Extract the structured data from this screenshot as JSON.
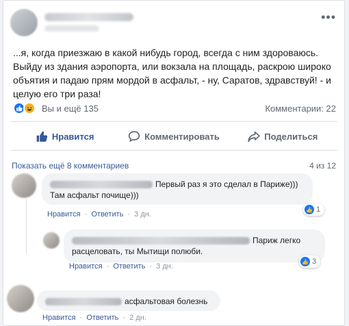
{
  "post": {
    "more_label": "•••",
    "text": "...я, когда приезжаю в какой нибудь город, всегда с ним здороваюсь. Выйду из здания аэропорта, или вокзала на площадь, раскрою широко объятия и падаю прям мордой в асфальт, - ну, Саратов, здравствуй! - и целую его три раза!",
    "reactions_text": "Вы и ещё 135",
    "comments_count": "Комментарии: 22",
    "actions": {
      "like": "Нравится",
      "comment": "Комментировать",
      "share": "Поделиться"
    },
    "accent": "#385898"
  },
  "comments_section": {
    "show_more": "Показать ещё 8 комментариев",
    "page_count": "4 из 12",
    "comments": [
      {
        "text_line1": "Первый раз я это сделал в Париже)))",
        "text_line2": "Там асфальт почище)))",
        "like": "Нравится",
        "reply": "Ответить",
        "time": "3 дн.",
        "likes": "1",
        "separator": "·"
      },
      {
        "text_line1": "Париж легко",
        "text_line2": "расцеловать, ты Мытищи полюби.",
        "like": "Нравится",
        "reply": "Ответить",
        "time": "3 дн.",
        "likes": "3",
        "separator": "·"
      },
      {
        "text_line1": "асфальтовая болезнь",
        "like": "Нравится",
        "reply": "Ответить",
        "time": "2 дн.",
        "separator": "·"
      }
    ]
  }
}
